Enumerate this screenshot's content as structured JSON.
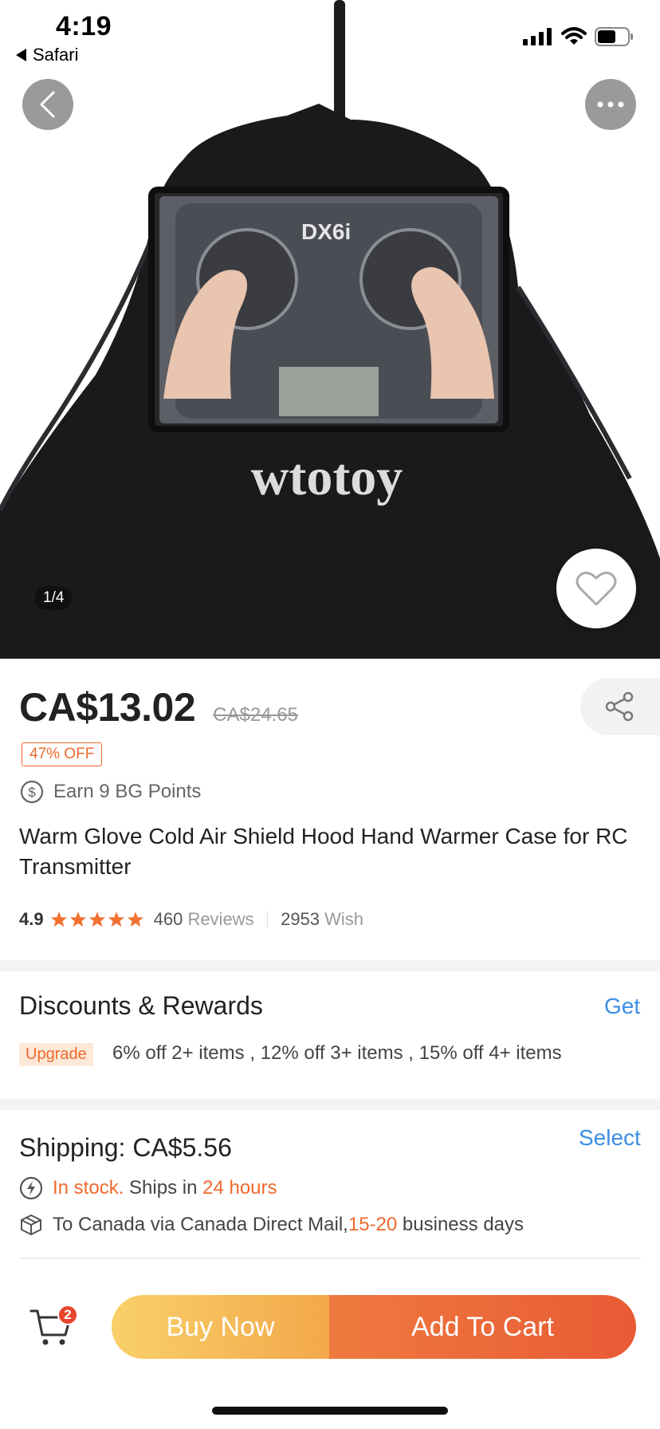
{
  "status_bar": {
    "time": "4:19",
    "back_app": "Safari"
  },
  "gallery": {
    "counter": "1/4",
    "brand_text": "wtotoy",
    "device_label": "DX6i"
  },
  "price": {
    "current": "CA$13.02",
    "original": "CA$24.65",
    "discount_badge": "47% OFF"
  },
  "points": {
    "text": "Earn 9 BG Points"
  },
  "product": {
    "title": "Warm Glove Cold Air Shield Hood Hand Warmer Case for RC Transmitter"
  },
  "rating": {
    "score": "4.9",
    "stars": 5,
    "review_count": "460",
    "review_label": "Reviews",
    "wish_count": "2953",
    "wish_label": "Wish"
  },
  "discounts": {
    "title": "Discounts & Rewards",
    "action": "Get",
    "badge": "Upgrade",
    "text": "6% off 2+ items , 12% off 3+ items , 15% off 4+ items"
  },
  "shipping": {
    "title": "Shipping: CA$5.56",
    "action": "Select",
    "stock_status": "In stock.",
    "ships_in_label": "Ships in",
    "ships_in_value": "24 hours",
    "route_label": "To Canada via Canada Direct Mail,",
    "days_value": "15-20",
    "days_label": "business days"
  },
  "bottom_bar": {
    "cart_count": "2",
    "buy_now": "Buy Now",
    "add_to_cart": "Add To Cart"
  },
  "colors": {
    "accent_orange": "#ee6a2e",
    "link_blue": "#3b8ee4",
    "star": "#f27132"
  }
}
